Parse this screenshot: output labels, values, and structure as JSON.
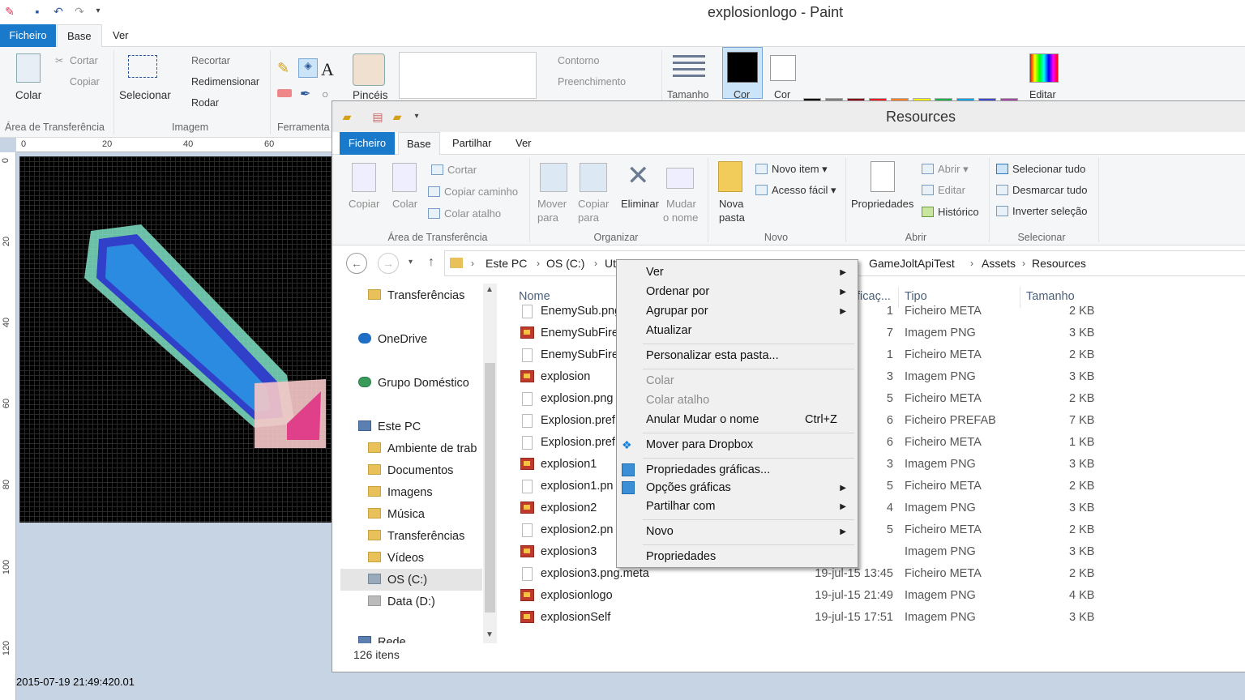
{
  "paint": {
    "title": "explosionlogo - Paint",
    "tabs": {
      "file": "Ficheiro",
      "home": "Base",
      "view": "Ver"
    },
    "clipboard": {
      "paste": "Colar",
      "cut": "Cortar",
      "copy": "Copiar",
      "group": "Área de Transferência"
    },
    "image": {
      "select": "Selecionar",
      "crop": "Recortar",
      "resize": "Redimensionar",
      "rotate": "Rodar",
      "group": "Imagem"
    },
    "tools": {
      "group": "Ferramenta"
    },
    "brushes": "Pincéis",
    "shapes": {
      "outline": "Contorno",
      "fill": "Preenchimento"
    },
    "size": "Tamanho",
    "color1": "Cor",
    "color2": "Cor",
    "edit_colors": "Editar",
    "ruler_top": [
      "0",
      "20",
      "40",
      "60"
    ],
    "ruler_left": [
      "0",
      "20",
      "40",
      "60",
      "80",
      "100",
      "120"
    ],
    "palette": [
      "#000000",
      "#7f7f7f",
      "#880015",
      "#ed1c24",
      "#ff7f27",
      "#fff200",
      "#22b14c",
      "#00a2e8",
      "#3f48cc",
      "#a349a4",
      "#ffffff",
      "#c3c3c3",
      "#b97a57",
      "#ffaec9",
      "#ffc90e",
      "#efe4b0",
      "#b5e61d",
      "#99d9ea",
      "#7092be",
      "#c8bfe7"
    ]
  },
  "timestamp": "2015-07-19 21:49:420.01",
  "explorer": {
    "title": "Resources",
    "tabs": {
      "file": "Ficheiro",
      "home": "Base",
      "share": "Partilhar",
      "view": "Ver"
    },
    "ribbon": {
      "copy": "Copiar",
      "paste": "Colar",
      "cut": "Cortar",
      "copy_path": "Copiar caminho",
      "paste_shortcut": "Colar atalho",
      "clipboard_group": "Área de Transferência",
      "move_to": "Mover",
      "move_to2": "para",
      "copy_to": "Copiar",
      "copy_to2": "para",
      "delete": "Eliminar",
      "rename": "Mudar",
      "rename2": "o nome",
      "organize_group": "Organizar",
      "new_folder": "Nova",
      "new_folder2": "pasta",
      "new_item": "Novo item",
      "easy_access": "Acesso fácil",
      "new_group": "Novo",
      "properties": "Propriedades",
      "open": "Abrir",
      "edit": "Editar",
      "history": "Histórico",
      "open_group": "Abrir",
      "select_all": "Selecionar tudo",
      "select_none": "Desmarcar tudo",
      "invert": "Inverter seleção",
      "select_group": "Selecionar"
    },
    "breadcrumb": [
      "Este PC",
      "OS (C:)",
      "Utili",
      "GameJoltApiTest",
      "Assets",
      "Resources"
    ],
    "nav": [
      "Transferências",
      "OneDrive",
      "Grupo Doméstico",
      "Este PC",
      "Ambiente de trab",
      "Documentos",
      "Imagens",
      "Música",
      "Transferências",
      "Vídeos",
      "OS (C:)",
      "Data (D:)",
      "Rede"
    ],
    "columns": {
      "name": "Nome",
      "modified": "ficaç...",
      "type": "Tipo",
      "size": "Tamanho"
    },
    "files": [
      {
        "name": "EnemySub.png",
        "date": "1",
        "type": "Ficheiro META",
        "size": "2 KB",
        "kind": "meta"
      },
      {
        "name": "EnemySubFire",
        "date": "7",
        "type": "Imagem PNG",
        "size": "3 KB",
        "kind": "png"
      },
      {
        "name": "EnemySubFire",
        "date": "1",
        "type": "Ficheiro META",
        "size": "2 KB",
        "kind": "meta"
      },
      {
        "name": "explosion",
        "date": "3",
        "type": "Imagem PNG",
        "size": "3 KB",
        "kind": "png"
      },
      {
        "name": "explosion.png",
        "date": "5",
        "type": "Ficheiro META",
        "size": "2 KB",
        "kind": "meta"
      },
      {
        "name": "Explosion.pref",
        "date": "6",
        "type": "Ficheiro PREFAB",
        "size": "7 KB",
        "kind": "meta"
      },
      {
        "name": "Explosion.pref",
        "date": "6",
        "type": "Ficheiro META",
        "size": "1 KB",
        "kind": "meta"
      },
      {
        "name": "explosion1",
        "date": "3",
        "type": "Imagem PNG",
        "size": "3 KB",
        "kind": "png"
      },
      {
        "name": "explosion1.pn",
        "date": "5",
        "type": "Ficheiro META",
        "size": "2 KB",
        "kind": "meta"
      },
      {
        "name": "explosion2",
        "date": "4",
        "type": "Imagem PNG",
        "size": "3 KB",
        "kind": "png"
      },
      {
        "name": "explosion2.pn",
        "date": "5",
        "type": "Ficheiro META",
        "size": "2 KB",
        "kind": "meta"
      },
      {
        "name": "explosion3",
        "date": "",
        "type": "Imagem PNG",
        "size": "3 KB",
        "kind": "png"
      },
      {
        "name": "explosion3.png.meta",
        "date": "19-jul-15 13:45",
        "type": "Ficheiro META",
        "size": "2 KB",
        "kind": "meta"
      },
      {
        "name": "explosionlogo",
        "date": "19-jul-15 21:49",
        "type": "Imagem PNG",
        "size": "4 KB",
        "kind": "png"
      },
      {
        "name": "explosionSelf",
        "date": "19-jul-15 17:51",
        "type": "Imagem PNG",
        "size": "3 KB",
        "kind": "png"
      }
    ],
    "status": "126 itens"
  },
  "context_menu": {
    "view": "Ver",
    "sort_by": "Ordenar por",
    "group_by": "Agrupar por",
    "refresh": "Atualizar",
    "customize": "Personalizar esta pasta...",
    "paste": "Colar",
    "paste_shortcut": "Colar atalho",
    "undo_rename": "Anular Mudar o nome",
    "undo_shortcut": "Ctrl+Z",
    "dropbox": "Mover para Dropbox",
    "graphics_props": "Propriedades gráficas...",
    "graphics_opts": "Opções gráficas",
    "share_with": "Partilhar com",
    "new": "Novo",
    "properties": "Propriedades"
  }
}
